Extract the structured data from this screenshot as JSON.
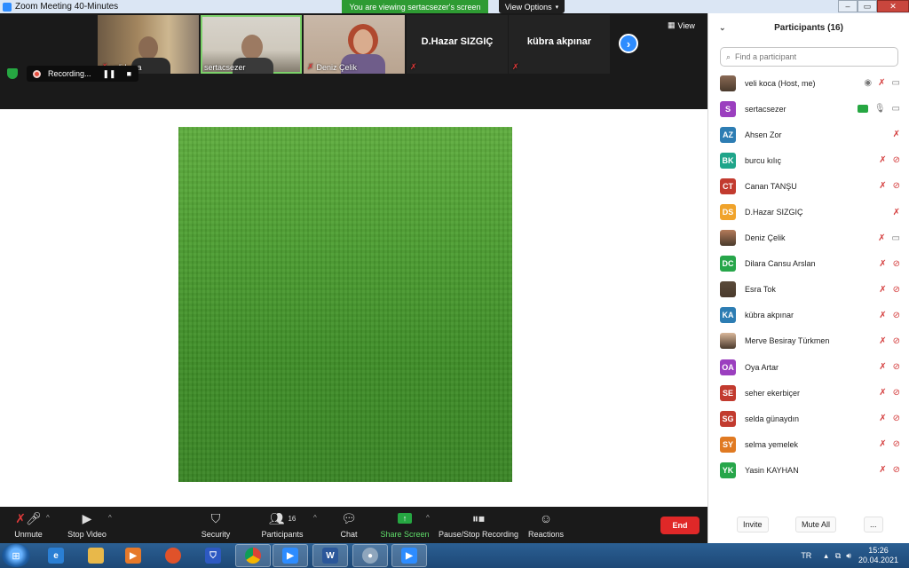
{
  "window": {
    "title": "Zoom Meeting 40-Minutes"
  },
  "banner": {
    "text": "You are viewing sertacsezer's screen"
  },
  "view_options": {
    "label": "View Options",
    "icon": "chevron-down-icon"
  },
  "gallery": {
    "tiles": [
      {
        "name": "veli koca",
        "muted": true,
        "type": "video"
      },
      {
        "name": "sertacsezer",
        "muted": false,
        "type": "video",
        "active": true
      },
      {
        "name": "Deniz Çelik",
        "muted": true,
        "type": "video"
      },
      {
        "name": "D.Hazar SIZGIÇ",
        "muted": true,
        "type": "name"
      },
      {
        "name": "kübra akpınar",
        "muted": true,
        "type": "name"
      }
    ],
    "view_label": "View"
  },
  "recording": {
    "label": "Recording..."
  },
  "panel": {
    "title": "Participants (16)",
    "search_placeholder": "Find a participant",
    "participants": [
      {
        "initials": "",
        "name": "veli koca (Host, me)",
        "color": "#8a6a55",
        "photo": true,
        "icons": [
          "record-icon",
          "mic-muted-icon",
          "video-icon"
        ]
      },
      {
        "initials": "S",
        "name": "sertacsezer",
        "color": "#9b3fbf",
        "photo": false,
        "icons": [
          "share-screen-icon",
          "mic-icon",
          "video-icon"
        ]
      },
      {
        "initials": "AZ",
        "name": "Ahsen Zor",
        "color": "#2d7db3",
        "photo": false,
        "icons": [
          "mic-muted-icon"
        ]
      },
      {
        "initials": "BK",
        "name": "burcu kılıç",
        "color": "#1fa58a",
        "photo": false,
        "icons": [
          "mic-muted-icon",
          "video-off-icon"
        ]
      },
      {
        "initials": "CT",
        "name": "Canan TANŞU",
        "color": "#c23b2f",
        "photo": false,
        "icons": [
          "mic-muted-icon",
          "video-off-icon"
        ]
      },
      {
        "initials": "DS",
        "name": "D.Hazar SIZGIÇ",
        "color": "#f0a32b",
        "photo": false,
        "icons": [
          "mic-muted-icon"
        ]
      },
      {
        "initials": "",
        "name": "Deniz Çelik",
        "color": "#b47b5a",
        "photo": true,
        "icons": [
          "mic-muted-icon",
          "video-icon"
        ]
      },
      {
        "initials": "DC",
        "name": "Dilara Cansu Arslan",
        "color": "#27a64a",
        "photo": false,
        "icons": [
          "mic-muted-icon",
          "video-off-icon"
        ]
      },
      {
        "initials": "",
        "name": "Esra Tok",
        "color": "#5a4a3a",
        "photo": true,
        "icons": [
          "mic-muted-icon",
          "video-off-icon"
        ]
      },
      {
        "initials": "KA",
        "name": "kübra akpınar",
        "color": "#2d7db3",
        "photo": false,
        "icons": [
          "mic-muted-icon",
          "video-off-icon"
        ]
      },
      {
        "initials": "",
        "name": "Merve Besiray Türkmen",
        "color": "#d9b79a",
        "photo": true,
        "icons": [
          "mic-muted-icon",
          "video-off-icon"
        ]
      },
      {
        "initials": "OA",
        "name": "Oya Artar",
        "color": "#9b3fbf",
        "photo": false,
        "icons": [
          "mic-muted-icon",
          "video-off-icon"
        ]
      },
      {
        "initials": "SE",
        "name": "seher ekerbiçer",
        "color": "#c23b2f",
        "photo": false,
        "icons": [
          "mic-muted-icon",
          "video-off-icon"
        ]
      },
      {
        "initials": "SG",
        "name": "selda günaydın",
        "color": "#c23b2f",
        "photo": false,
        "icons": [
          "mic-muted-icon",
          "video-off-icon"
        ]
      },
      {
        "initials": "SY",
        "name": "selma yemelek",
        "color": "#e07a22",
        "photo": false,
        "icons": [
          "mic-muted-icon",
          "video-off-icon"
        ]
      },
      {
        "initials": "YK",
        "name": "Yasin KAYHAN",
        "color": "#27a64a",
        "photo": false,
        "icons": [
          "mic-muted-icon",
          "video-off-icon"
        ]
      }
    ],
    "invite_label": "Invite",
    "mute_all_label": "Mute All",
    "more_label": "..."
  },
  "toolbar": {
    "unmute": "Unmute",
    "stop_video": "Stop Video",
    "security": "Security",
    "participants": "Participants",
    "participants_count": "16",
    "chat": "Chat",
    "share_screen": "Share Screen",
    "pause_stop_recording": "Pause/Stop Recording",
    "reactions": "Reactions",
    "end": "End"
  },
  "taskbar": {
    "language": "TR",
    "time": "15:26",
    "date": "20.04.2021",
    "apps": [
      "internet-explorer-icon",
      "file-explorer-icon",
      "media-player-icon",
      "firefox-icon",
      "security-app-icon",
      "chrome-icon",
      "zoom-icon",
      "word-icon",
      "webcam-app-icon",
      "zoom-icon"
    ]
  }
}
